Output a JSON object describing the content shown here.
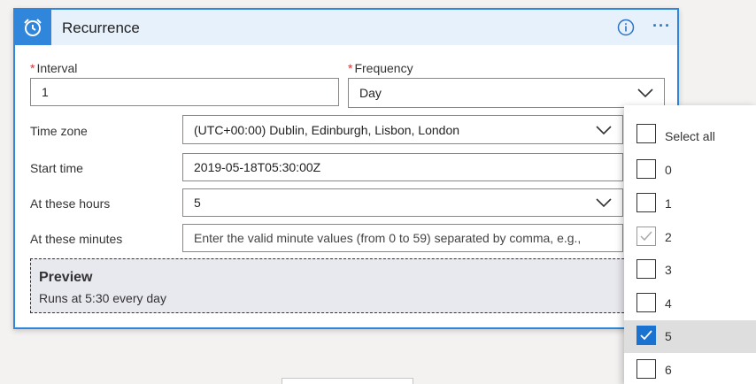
{
  "card": {
    "title": "Recurrence",
    "icons": {
      "header": "alarm-clock-icon",
      "info": "info-icon",
      "more": "ellipsis-icon"
    }
  },
  "interval": {
    "label": "Interval",
    "value": "1",
    "required": "*"
  },
  "frequency": {
    "label": "Frequency",
    "value": "Day",
    "required": "*"
  },
  "time_zone": {
    "label": "Time zone",
    "value": "(UTC+00:00) Dublin, Edinburgh, Lisbon, London"
  },
  "start_time": {
    "label": "Start time",
    "value": "2019-05-18T05:30:00Z"
  },
  "hours": {
    "label": "At these hours",
    "value": "5"
  },
  "minutes": {
    "label": "At these minutes",
    "placeholder": "Enter the valid minute values (from 0 to 59) separated by comma, e.g.,"
  },
  "preview": {
    "title": "Preview",
    "text": "Runs at 5:30 every day"
  },
  "hour_dropdown": {
    "select_all": "Select all",
    "options": [
      {
        "label": "0",
        "state": "unchecked"
      },
      {
        "label": "1",
        "state": "unchecked"
      },
      {
        "label": "2",
        "state": "checked-faint"
      },
      {
        "label": "3",
        "state": "unchecked"
      },
      {
        "label": "4",
        "state": "unchecked"
      },
      {
        "label": "5",
        "state": "checked"
      },
      {
        "label": "6",
        "state": "unchecked"
      }
    ]
  },
  "colors": {
    "accent": "#2f86da",
    "header_bg": "#e6f1fb",
    "required": "#d13438",
    "checked": "#1a73d1"
  }
}
